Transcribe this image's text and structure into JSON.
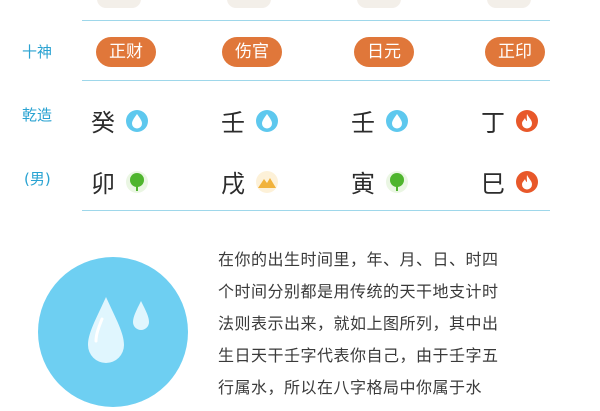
{
  "table": {
    "rows": [
      {
        "label": "十神",
        "pills": [
          "正财",
          "伤官",
          "日元",
          "正印"
        ]
      },
      {
        "label": "乾造",
        "chars": [
          "癸",
          "壬",
          "壬",
          "丁"
        ],
        "elements": [
          "water",
          "water",
          "water",
          "fire"
        ]
      },
      {
        "label": "(男)",
        "chars": [
          "卯",
          "戌",
          "寅",
          "巳"
        ],
        "elements": [
          "wood",
          "earth",
          "wood",
          "fire"
        ]
      }
    ]
  },
  "description": {
    "lines": [
      "在你的出生时间里，年、月、日、时四",
      "个时间分别都是用传统的天干地支计时",
      "法则表示出来，就如上图所列，其中出",
      "生日天干壬字代表你自己，由于壬字五",
      "行属水，所以在八字格局中你属于水"
    ]
  },
  "colors": {
    "accent_blue": "#2aa3d2",
    "pill_orange": "#e0773a",
    "water": "#5ec8ee",
    "fire": "#e8582a",
    "wood": "#4fb52e",
    "earth": "#f1b23b"
  },
  "icons": {
    "water": "water-drop-icon",
    "fire": "flame-icon",
    "wood": "tree-icon",
    "earth": "mountain-icon",
    "hero": "water-drops-illustration"
  }
}
